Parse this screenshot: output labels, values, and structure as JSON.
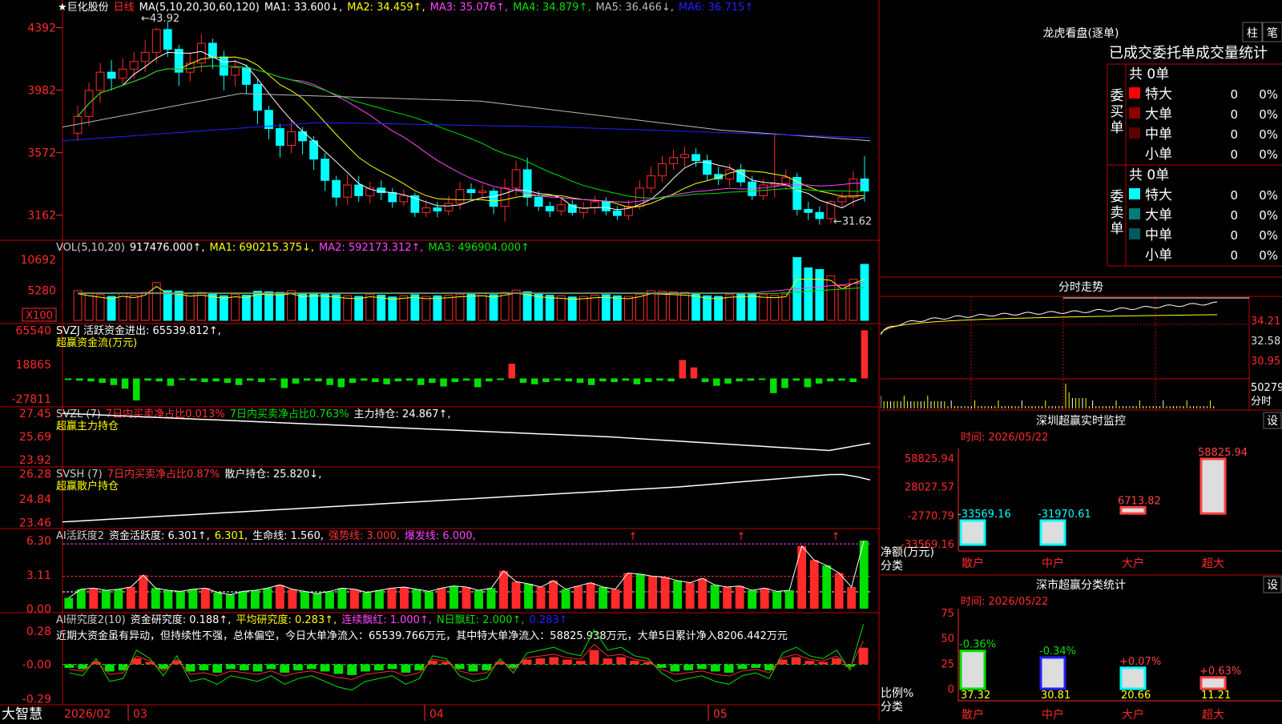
{
  "app": {
    "brand": "大智慧",
    "dates": {
      "start": "2026/02",
      "m3": "03",
      "m4": "04",
      "m5": "05"
    }
  },
  "kline": {
    "header": {
      "star": "★巨化股份",
      "period": "日线",
      "ma_label": "MA(5,10,20,30,60,120)",
      "ma": [
        {
          "label": "MA1: 33.600↓,",
          "color": "#ffffff"
        },
        {
          "label": "MA2: 34.459↑,",
          "color": "#ffff00"
        },
        {
          "label": "MA3: 35.076↑,",
          "color": "#ff44ff"
        },
        {
          "label": "MA4: 34.879↑,",
          "color": "#00e000"
        },
        {
          "label": "MA5: 36.466↓,",
          "color": "#bbbbbb"
        },
        {
          "label": "MA6: 36.715↑",
          "color": "#2222ff"
        }
      ]
    },
    "yaxis": [
      "4392",
      "3982",
      "3572",
      "3162"
    ],
    "annot_high": "43.92",
    "annot_low": "31.62",
    "candles": [
      [
        37.0,
        38.1,
        36.7,
        38.8,
        36.5
      ],
      [
        38.1,
        39.8,
        37.8,
        40.3,
        37.5
      ],
      [
        39.8,
        41.0,
        39.3,
        41.6,
        39.0
      ],
      [
        41.0,
        40.6,
        40.2,
        41.8,
        39.8
      ],
      [
        40.6,
        41.2,
        40.5,
        41.9,
        40.2
      ],
      [
        41.2,
        41.7,
        40.9,
        42.3,
        40.6
      ],
      [
        41.7,
        42.3,
        41.4,
        43.1,
        41.0
      ],
      [
        42.3,
        43.8,
        42.0,
        43.92,
        41.6
      ],
      [
        43.8,
        42.5,
        42.2,
        44.3,
        42.0
      ],
      [
        42.5,
        41.0,
        40.5,
        42.8,
        40.1
      ],
      [
        41.0,
        41.6,
        40.7,
        42.3,
        40.4
      ],
      [
        41.6,
        42.9,
        41.4,
        43.5,
        41.0
      ],
      [
        42.9,
        42.0,
        41.6,
        43.2,
        41.2
      ],
      [
        42.0,
        40.8,
        40.4,
        42.4,
        39.8
      ],
      [
        40.8,
        41.3,
        40.6,
        41.8,
        40.1
      ],
      [
        41.3,
        40.2,
        39.8,
        41.5,
        39.6
      ],
      [
        40.2,
        38.5,
        38.0,
        40.6,
        37.6
      ],
      [
        38.5,
        37.3,
        36.9,
        38.8,
        36.6
      ],
      [
        37.3,
        36.2,
        35.8,
        37.6,
        35.4
      ],
      [
        36.2,
        37.1,
        36.0,
        37.8,
        35.7
      ],
      [
        37.1,
        36.5,
        36.0,
        37.4,
        35.6
      ],
      [
        36.5,
        35.3,
        34.9,
        36.8,
        34.6
      ],
      [
        35.3,
        33.9,
        33.5,
        35.7,
        33.2
      ],
      [
        33.9,
        32.8,
        32.5,
        34.2,
        32.2
      ],
      [
        32.8,
        33.6,
        32.6,
        34.3,
        32.3
      ],
      [
        33.6,
        32.9,
        32.7,
        34.2,
        32.5
      ],
      [
        32.9,
        33.4,
        32.8,
        33.8,
        32.4
      ],
      [
        33.4,
        33.1,
        32.9,
        33.9,
        32.6
      ],
      [
        33.1,
        32.5,
        32.3,
        33.4,
        32.1
      ],
      [
        32.5,
        32.9,
        32.4,
        33.3,
        32.2
      ],
      [
        32.9,
        31.8,
        31.6,
        33.1,
        31.5
      ],
      [
        31.8,
        32.1,
        31.7,
        32.6,
        31.5
      ],
      [
        32.1,
        31.9,
        31.7,
        32.5,
        31.5
      ],
      [
        31.9,
        32.4,
        31.8,
        32.9,
        31.6
      ],
      [
        32.4,
        33.3,
        32.2,
        33.8,
        32.0
      ],
      [
        33.3,
        33.1,
        32.9,
        33.7,
        32.7
      ],
      [
        33.1,
        33.2,
        32.8,
        33.6,
        32.6
      ],
      [
        33.2,
        32.2,
        31.9,
        33.4,
        31.7
      ],
      [
        32.2,
        33.4,
        32.1,
        34.0,
        31.2
      ],
      [
        33.4,
        34.6,
        33.2,
        35.2,
        32.9
      ],
      [
        34.6,
        32.8,
        32.4,
        35.4,
        32.2
      ],
      [
        32.8,
        32.2,
        32.0,
        33.2,
        31.9
      ],
      [
        32.2,
        31.9,
        31.6,
        32.5,
        31.5
      ],
      [
        31.9,
        32.3,
        31.8,
        32.8,
        31.6
      ],
      [
        32.3,
        31.8,
        31.7,
        32.6,
        31.6
      ],
      [
        31.8,
        32.1,
        31.6,
        32.5,
        31.4
      ],
      [
        32.1,
        32.5,
        31.9,
        32.9,
        31.7
      ],
      [
        32.5,
        31.9,
        31.7,
        32.8,
        31.6
      ],
      [
        31.9,
        31.6,
        31.4,
        32.2,
        31.3
      ],
      [
        31.6,
        32.2,
        31.5,
        32.6,
        31.3
      ],
      [
        32.2,
        33.4,
        32.1,
        33.9,
        32.0
      ],
      [
        33.4,
        34.2,
        33.3,
        34.8,
        33.1
      ],
      [
        34.2,
        35.0,
        34.1,
        35.5,
        33.8
      ],
      [
        35.0,
        35.4,
        34.9,
        35.9,
        34.6
      ],
      [
        35.4,
        35.6,
        35.2,
        36.1,
        34.8
      ],
      [
        35.6,
        35.2,
        35.0,
        36.0,
        34.8
      ],
      [
        35.2,
        34.3,
        34.0,
        35.6,
        33.9
      ],
      [
        34.3,
        34.0,
        33.8,
        34.8,
        33.6
      ],
      [
        34.0,
        34.6,
        33.9,
        35.0,
        33.5
      ],
      [
        34.6,
        33.8,
        33.6,
        35.0,
        33.5
      ],
      [
        33.8,
        32.9,
        32.7,
        34.2,
        32.6
      ],
      [
        32.9,
        33.6,
        32.8,
        34.0,
        32.6
      ],
      [
        33.6,
        33.7,
        33.0,
        37.0,
        32.8
      ],
      [
        33.7,
        34.1,
        33.5,
        34.6,
        33.3
      ],
      [
        34.1,
        32.0,
        31.8,
        34.4,
        31.6
      ],
      [
        32.0,
        31.8,
        31.5,
        32.5,
        31.3
      ],
      [
        31.8,
        31.4,
        31.2,
        32.2,
        31.0
      ],
      [
        31.4,
        32.5,
        31.62,
        32.6,
        31.1
      ],
      [
        32.5,
        32.8,
        32.3,
        33.1,
        32.1
      ],
      [
        32.8,
        34.0,
        32.6,
        34.5,
        32.2
      ],
      [
        34.0,
        33.2,
        32.7,
        35.5,
        32.5
      ]
    ]
  },
  "vol": {
    "header": [
      {
        "label": "VOL(5,10,20)",
        "color": "#cccccc"
      },
      {
        "label": "917476.000↑,",
        "color": "#ffffff"
      },
      {
        "label": "MA1: 690215.375↓,",
        "color": "#ffff00"
      },
      {
        "label": "MA2: 592173.312↑,",
        "color": "#ff44ff"
      },
      {
        "label": "MA3: 496904.000↑",
        "color": "#00e000"
      }
    ],
    "yaxis": [
      "10692",
      "5280",
      "X100"
    ],
    "values": [
      5200,
      4800,
      4500,
      4200,
      4700,
      4400,
      4900,
      6600,
      5200,
      5100,
      4700,
      4900,
      4600,
      4300,
      4600,
      4400,
      5100,
      5000,
      4900,
      5200,
      4600,
      4800,
      4700,
      4500,
      4300,
      4200,
      4600,
      4400,
      4100,
      4300,
      4500,
      4200,
      4300,
      4400,
      4600,
      4700,
      4800,
      4500,
      4900,
      5300,
      5000,
      4600,
      4400,
      4300,
      4100,
      4200,
      4400,
      4500,
      4300,
      4200,
      4600,
      5200,
      5100,
      5000,
      4900,
      4700,
      4300,
      4200,
      4500,
      4600,
      4700,
      4500,
      4400,
      4600,
      11000,
      9200,
      8900,
      7800,
      6100,
      7200,
      9800
    ]
  },
  "svzj": {
    "header": [
      {
        "label": "SVZJ  活跃资金进出: 65539.812↑,",
        "color": "#ffffff"
      },
      {
        "label": "超赢资金流(万元)",
        "color": "#ffff00"
      }
    ],
    "yaxis": [
      "65540",
      "18865",
      "-27811"
    ],
    "values": [
      -2000,
      -3000,
      -4000,
      -6000,
      -9000,
      -14000,
      -30000,
      -3000,
      -4000,
      -10000,
      -2000,
      -3000,
      -5000,
      -4000,
      -6000,
      -9000,
      -3000,
      -5000,
      -2000,
      -13000,
      -7000,
      -3000,
      -4000,
      -9000,
      -12000,
      -6000,
      -3000,
      -5000,
      -8000,
      -4000,
      -3000,
      -9000,
      -6000,
      -11000,
      -5000,
      -3000,
      -12000,
      -4000,
      -2000,
      20000,
      -6000,
      -8000,
      -5000,
      -3000,
      -4000,
      -6000,
      -9000,
      -4000,
      -5000,
      -3000,
      -8000,
      -5000,
      -3000,
      -4000,
      25000,
      15000,
      -5000,
      -10000,
      -7000,
      -4000,
      -3000,
      -2000,
      -20000,
      -13000,
      -3000,
      -12000,
      -7000,
      -4000,
      -3000,
      -5000,
      65539
    ]
  },
  "svzl": {
    "header": [
      {
        "label": "SVZL (7)",
        "color": "#cccccc"
      },
      {
        "label": "7日内买卖净占比0.013%",
        "color": "#ff3333"
      },
      {
        "label": "7日内买卖净占比0.763%",
        "color": "#00e000"
      },
      {
        "label": "主力持仓: 24.867↑,",
        "color": "#ffffff"
      },
      {
        "label": "超赢主力持仓",
        "color": "#ffff00"
      }
    ],
    "yaxis": [
      "27.45",
      "25.69",
      "23.92"
    ],
    "range": [
      23.6,
      27.7
    ]
  },
  "svsh": {
    "header": [
      {
        "label": "SVSH (7)",
        "color": "#cccccc"
      },
      {
        "label": "7日内买卖净占比0.87%",
        "color": "#ff3333"
      },
      {
        "label": "散户持仓: 25.820↓,",
        "color": "#ffffff"
      },
      {
        "label": "超赢散户持仓",
        "color": "#ffff00"
      }
    ],
    "yaxis": [
      "26.28",
      "24.84",
      "23.46"
    ],
    "range": [
      23.3,
      26.5
    ]
  },
  "ai_act": {
    "header": [
      {
        "label": "AI活跃度2",
        "color": "#cccccc"
      },
      {
        "label": "资金活跃度: 6.301↑,",
        "color": "#ffffff"
      },
      {
        "label": "6.301,",
        "color": "#ffff00"
      },
      {
        "label": "生命线: 1.560,",
        "color": "#ffffff"
      },
      {
        "label": "强势线: 3.000,",
        "color": "#ff3333"
      },
      {
        "label": "爆发线: 6.000,",
        "color": "#ff44ff"
      }
    ],
    "yaxis": [
      "6.30",
      "3.11",
      "0.00"
    ],
    "values": [
      1.0,
      1.8,
      1.9,
      1.7,
      1.8,
      2.0,
      3.1,
      1.9,
      1.7,
      1.6,
      1.8,
      1.9,
      1.5,
      1.3,
      1.6,
      1.7,
      1.9,
      2.2,
      1.8,
      1.6,
      1.4,
      1.6,
      1.9,
      1.8,
      1.5,
      1.7,
      1.9,
      2.0,
      1.8,
      1.6,
      1.9,
      2.1,
      2.0,
      1.7,
      1.9,
      3.5,
      2.5,
      2.3,
      2.0,
      2.6,
      1.8,
      2.1,
      2.4,
      2.0,
      1.8,
      3.3,
      3.2,
      3.0,
      2.9,
      2.6,
      2.4,
      2.8,
      2.2,
      2.0,
      2.1,
      1.7,
      1.9,
      1.6,
      1.7,
      5.8,
      4.5,
      4.0,
      3.3,
      2.0,
      6.3
    ]
  },
  "ai_res": {
    "header": [
      {
        "label": "AI研究度2(10)",
        "color": "#cccccc"
      },
      {
        "label": "资金研究度: 0.188↑,",
        "color": "#ffffff"
      },
      {
        "label": "平均研究度: 0.283↑,",
        "color": "#ffff00"
      },
      {
        "label": "连续飘红: 1.000↑,",
        "color": "#ff44ff"
      },
      {
        "label": "N日飘红: 2.000↑,",
        "color": "#00e000"
      },
      {
        "label": "0.283↑",
        "color": "#2222ff"
      }
    ],
    "comment": "近期大资金虽有异动，但持续性不强，总体偏空，今日大单净流入：65539.766万元，其中特大单净流入：58825.938万元，大单5日累计净入8206.442万元",
    "yaxis": [
      "0.28",
      "-0.00",
      "-0.29"
    ],
    "values": [
      -0.03,
      -0.04,
      0.02,
      -0.06,
      -0.05,
      0.05,
      0.02,
      -0.04,
      0.03,
      -0.06,
      -0.05,
      -0.07,
      -0.04,
      -0.05,
      -0.06,
      -0.04,
      -0.07,
      -0.05,
      -0.04,
      -0.06,
      -0.08,
      -0.09,
      -0.06,
      -0.05,
      -0.04,
      -0.07,
      -0.05,
      0.03,
      0.02,
      -0.04,
      -0.06,
      -0.05,
      0.02,
      -0.03,
      0.04,
      0.05,
      0.06,
      0.04,
      0.03,
      0.12,
      0.05,
      0.06,
      0.03,
      0.02,
      -0.03,
      -0.06,
      -0.05,
      -0.04,
      -0.06,
      -0.07,
      -0.04,
      -0.03,
      -0.05,
      0.04,
      0.06,
      0.03,
      0.02,
      0.05,
      -0.02,
      0.14
    ]
  },
  "lhb": {
    "title": "龙虎看盘(逐单)",
    "tab1": "柱",
    "tab2": "笔",
    "subtitle": "已成交委托单成交量统计",
    "buy": {
      "side": "委买单",
      "total": "共 0单",
      "rows": [
        {
          "label": "特大",
          "color": "#ff0000",
          "num": "0",
          "pct": "0%"
        },
        {
          "label": "大单",
          "color": "#8b0000",
          "num": "0",
          "pct": "0%"
        },
        {
          "label": "中单",
          "color": "#5a0000",
          "num": "0",
          "pct": "0%"
        },
        {
          "label": "小单",
          "color": "",
          "num": "0",
          "pct": "0%"
        }
      ]
    },
    "sell": {
      "side": "委卖单",
      "total": "共 0单",
      "rows": [
        {
          "label": "特大",
          "color": "#00ffff",
          "num": "0",
          "pct": "0%"
        },
        {
          "label": "大单",
          "color": "#007a7a",
          "num": "0",
          "pct": "0%"
        },
        {
          "label": "中单",
          "color": "#005a5a",
          "num": "0",
          "pct": "0%"
        },
        {
          "label": "小单",
          "color": "",
          "num": "0",
          "pct": "0%"
        }
      ]
    }
  },
  "intraday": {
    "title": "分时走势",
    "y": [
      "34.21",
      "32.58",
      "30.95"
    ],
    "vol": "50279",
    "vol2": "分时"
  },
  "monitor": {
    "title": "深圳超赢实时监控",
    "set": "设",
    "time": "时间: 2026/05/22",
    "yaxis": [
      "58825.94",
      "28027.57",
      "-2770.79",
      "-33569.16"
    ],
    "ylabel1": "净额(万元)",
    "ylabel2": "分类",
    "chart_data": {
      "type": "bar",
      "categories": [
        "散户",
        "中户",
        "大户",
        "超大"
      ],
      "values": [
        -33569.16,
        -31970.61,
        6713.82,
        58825.94
      ],
      "labels": [
        "-33569.16",
        "-31970.61",
        "6713.82",
        "58825.94"
      ],
      "ylim": [
        -33569.16,
        58825.94
      ]
    }
  },
  "classify": {
    "title": "深市超赢分类统计",
    "set": "设",
    "time": "时间: 2026/05/22",
    "yaxis": [
      "75",
      "50",
      "25",
      "0"
    ],
    "ylabel1": "比例%",
    "ylabel2": "分类",
    "chart_data": {
      "type": "bar",
      "categories": [
        "散户",
        "中户",
        "大户",
        "超大"
      ],
      "values": [
        37.32,
        30.81,
        20.66,
        11.21
      ],
      "bottom_labels": [
        "37.32",
        "30.81",
        "20.66",
        "11.21"
      ],
      "change_labels": [
        "-0.36%",
        "-0.34%",
        "+0.07%",
        "+0.63%"
      ],
      "ylim": [
        0,
        75
      ]
    }
  }
}
